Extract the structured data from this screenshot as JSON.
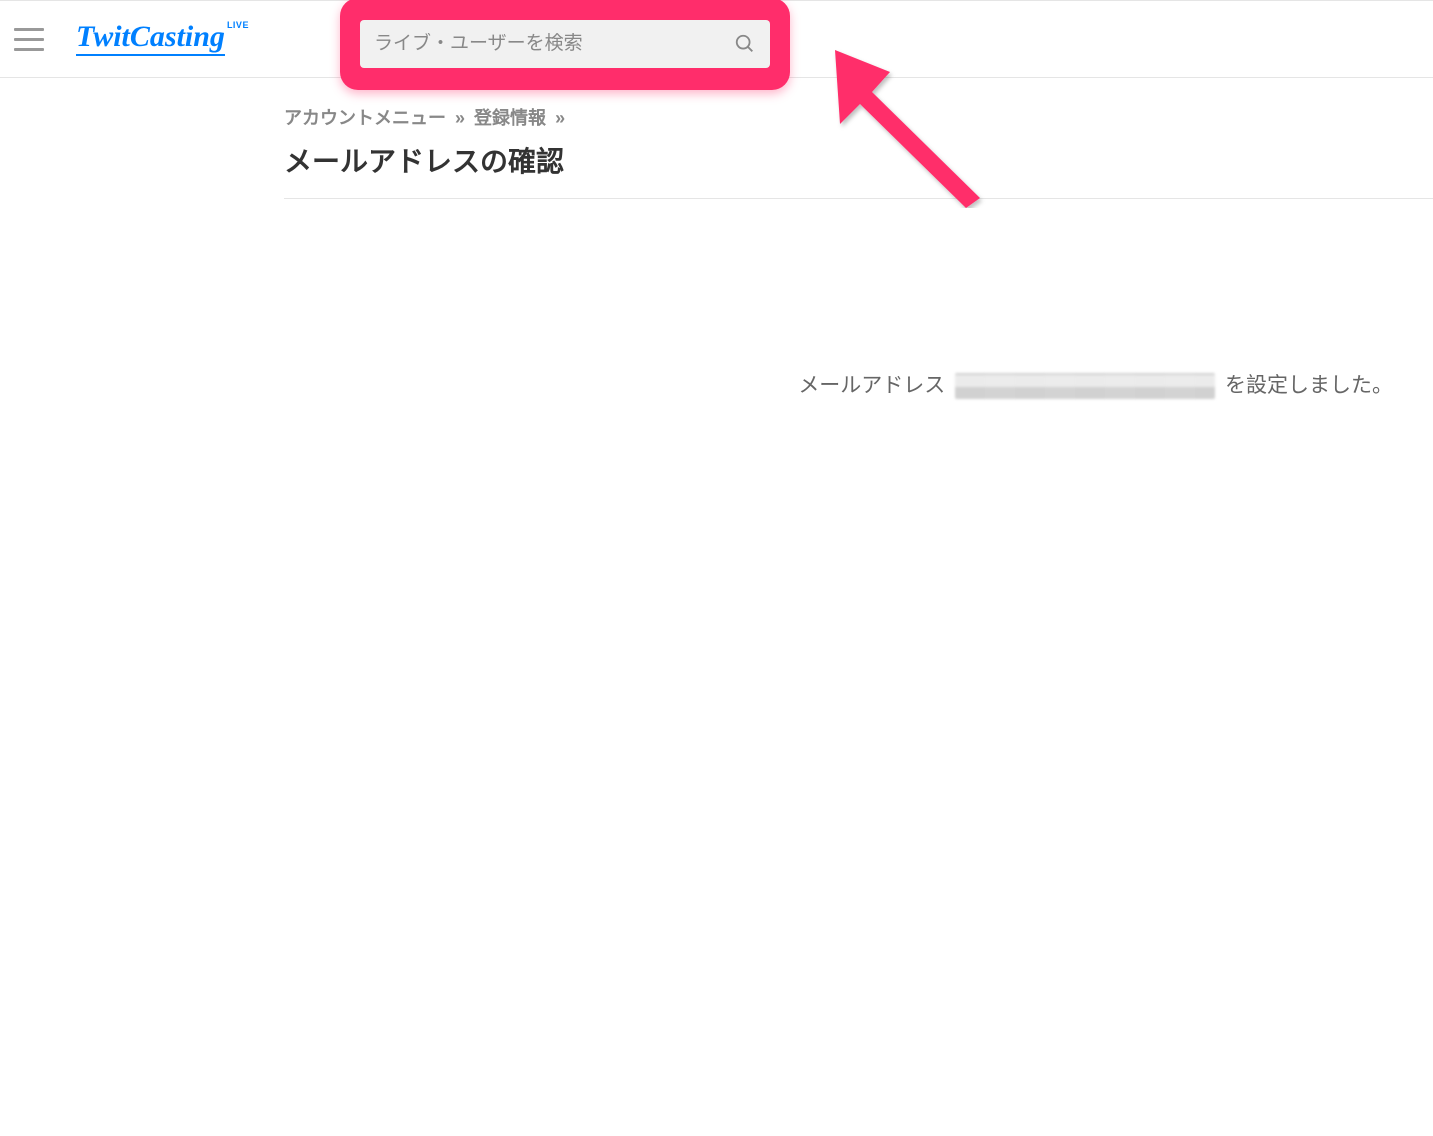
{
  "header": {
    "logo_text": "TwitCasting",
    "logo_super": "LIVE",
    "search_placeholder": "ライブ・ユーザーを検索"
  },
  "breadcrumb": {
    "item1": "アカウントメニュー",
    "sep": "»",
    "item2": "登録情報"
  },
  "page": {
    "title": "メールアドレスの確認"
  },
  "message": {
    "prefix": "メールアドレス ",
    "suffix": " を設定しました。"
  },
  "annotation": {
    "highlight_color": "#ff2d6b"
  }
}
